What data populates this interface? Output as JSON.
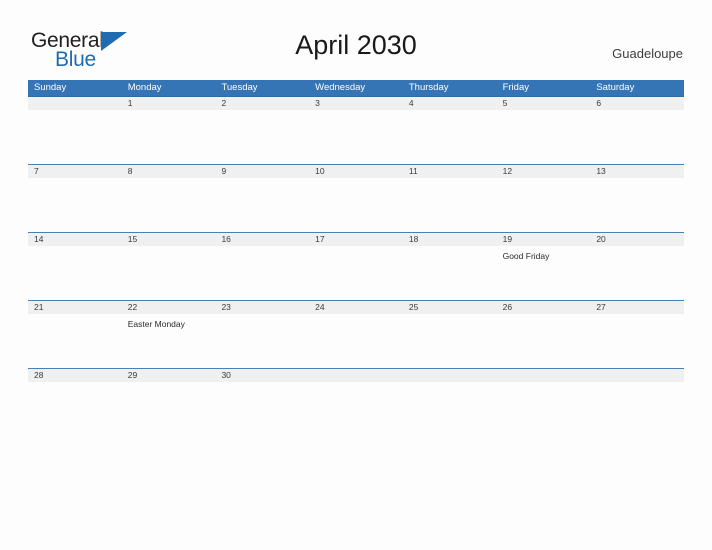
{
  "brand": {
    "name_part1": "General",
    "name_part2": "Blue",
    "triangle_icon": "triangle-icon",
    "accent_color": "#1f6cb0"
  },
  "header": {
    "title": "April 2030",
    "location": "Guadeloupe"
  },
  "colors": {
    "header_blue": "#3575b5",
    "row_line": "#4a7ebb",
    "band_gray": "#f0f0f0",
    "page_background": "#fdfdfd"
  },
  "calendar": {
    "weekdays": [
      "Sunday",
      "Monday",
      "Tuesday",
      "Wednesday",
      "Thursday",
      "Friday",
      "Saturday"
    ],
    "weeks": [
      {
        "days": [
          {
            "number": "",
            "event": ""
          },
          {
            "number": "1",
            "event": ""
          },
          {
            "number": "2",
            "event": ""
          },
          {
            "number": "3",
            "event": ""
          },
          {
            "number": "4",
            "event": ""
          },
          {
            "number": "5",
            "event": ""
          },
          {
            "number": "6",
            "event": ""
          }
        ]
      },
      {
        "days": [
          {
            "number": "7",
            "event": ""
          },
          {
            "number": "8",
            "event": ""
          },
          {
            "number": "9",
            "event": ""
          },
          {
            "number": "10",
            "event": ""
          },
          {
            "number": "11",
            "event": ""
          },
          {
            "number": "12",
            "event": ""
          },
          {
            "number": "13",
            "event": ""
          }
        ]
      },
      {
        "days": [
          {
            "number": "14",
            "event": ""
          },
          {
            "number": "15",
            "event": ""
          },
          {
            "number": "16",
            "event": ""
          },
          {
            "number": "17",
            "event": ""
          },
          {
            "number": "18",
            "event": ""
          },
          {
            "number": "19",
            "event": "Good Friday"
          },
          {
            "number": "20",
            "event": ""
          }
        ]
      },
      {
        "days": [
          {
            "number": "21",
            "event": ""
          },
          {
            "number": "22",
            "event": "Easter Monday"
          },
          {
            "number": "23",
            "event": ""
          },
          {
            "number": "24",
            "event": ""
          },
          {
            "number": "25",
            "event": ""
          },
          {
            "number": "26",
            "event": ""
          },
          {
            "number": "27",
            "event": ""
          }
        ]
      },
      {
        "days": [
          {
            "number": "28",
            "event": ""
          },
          {
            "number": "29",
            "event": ""
          },
          {
            "number": "30",
            "event": ""
          },
          {
            "number": "",
            "event": ""
          },
          {
            "number": "",
            "event": ""
          },
          {
            "number": "",
            "event": ""
          },
          {
            "number": "",
            "event": ""
          }
        ]
      }
    ]
  }
}
